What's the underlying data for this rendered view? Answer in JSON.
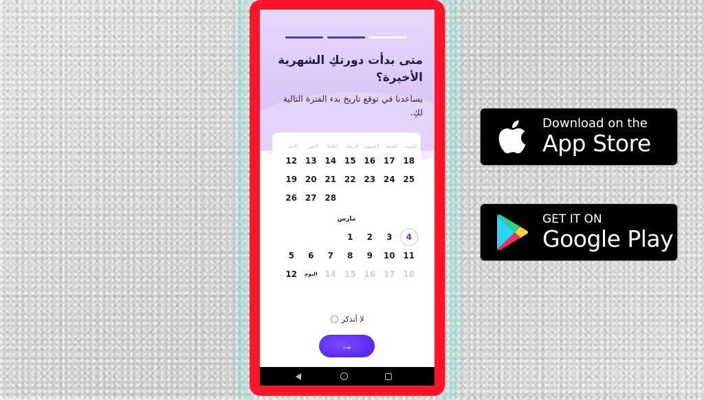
{
  "app": {
    "progress": {
      "total_steps": 3,
      "completed_steps": 2
    },
    "question": {
      "title": "متى بدأت دورتكِ الشهرية الأخيرة؟",
      "subtitle": "يساعدنا في توقع تاريخ بدء الفترة التالية لكِ."
    },
    "calendar": {
      "weekdays": [
        "السبت",
        "الجمعة",
        "الخميس",
        "الأربعاء",
        "الثلاثاء",
        "الاثنين",
        "الأحد"
      ],
      "previous_month": {
        "days": [
          {
            "label": "18",
            "state": "normal"
          },
          {
            "label": "17",
            "state": "normal"
          },
          {
            "label": "16",
            "state": "normal"
          },
          {
            "label": "15",
            "state": "normal"
          },
          {
            "label": "14",
            "state": "normal"
          },
          {
            "label": "13",
            "state": "normal"
          },
          {
            "label": "12",
            "state": "normal"
          },
          {
            "label": "25",
            "state": "normal"
          },
          {
            "label": "24",
            "state": "normal"
          },
          {
            "label": "23",
            "state": "normal"
          },
          {
            "label": "22",
            "state": "normal"
          },
          {
            "label": "21",
            "state": "normal"
          },
          {
            "label": "20",
            "state": "normal"
          },
          {
            "label": "19",
            "state": "normal"
          },
          {
            "label": "",
            "state": "empty"
          },
          {
            "label": "",
            "state": "empty"
          },
          {
            "label": "",
            "state": "empty"
          },
          {
            "label": "",
            "state": "empty"
          },
          {
            "label": "28",
            "state": "normal"
          },
          {
            "label": "27",
            "state": "normal"
          },
          {
            "label": "26",
            "state": "normal"
          }
        ]
      },
      "current_month": {
        "name": "مارس",
        "days": [
          {
            "label": "4",
            "state": "selected"
          },
          {
            "label": "3",
            "state": "normal"
          },
          {
            "label": "2",
            "state": "normal"
          },
          {
            "label": "1",
            "state": "normal"
          },
          {
            "label": "",
            "state": "empty"
          },
          {
            "label": "",
            "state": "empty"
          },
          {
            "label": "",
            "state": "empty"
          },
          {
            "label": "11",
            "state": "normal"
          },
          {
            "label": "10",
            "state": "normal"
          },
          {
            "label": "9",
            "state": "normal"
          },
          {
            "label": "8",
            "state": "normal"
          },
          {
            "label": "7",
            "state": "normal"
          },
          {
            "label": "6",
            "state": "normal"
          },
          {
            "label": "5",
            "state": "normal"
          },
          {
            "label": "18",
            "state": "future"
          },
          {
            "label": "17",
            "state": "future"
          },
          {
            "label": "16",
            "state": "future"
          },
          {
            "label": "15",
            "state": "future"
          },
          {
            "label": "14",
            "state": "future"
          },
          {
            "label": "اليوم",
            "state": "today"
          },
          {
            "label": "12",
            "state": "normal"
          }
        ]
      }
    },
    "dont_remember_label": "لا أتذكر",
    "next_button_icon": "→",
    "colors": {
      "accent": "#5a2cf0",
      "frame": "#ff1428",
      "progress_done": "#4a36c8"
    }
  },
  "badges": {
    "apple": {
      "small": "Download on the",
      "big": "App Store"
    },
    "google": {
      "small": "GET IT ON",
      "big": "Google Play"
    }
  }
}
